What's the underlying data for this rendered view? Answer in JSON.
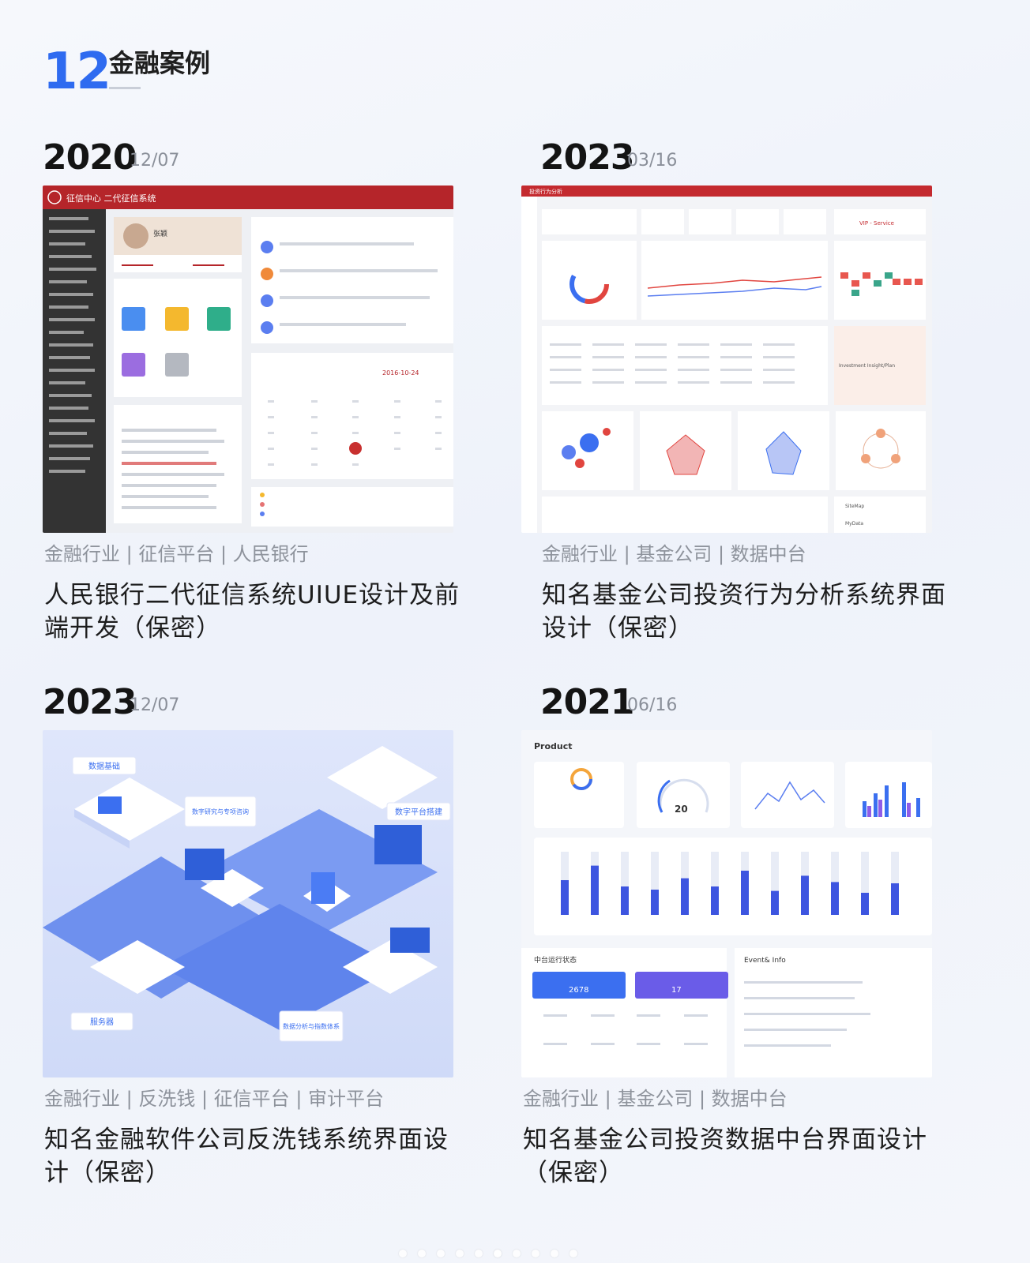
{
  "section": {
    "number": "12",
    "title": "金融案例"
  },
  "cases": [
    {
      "year": "2020",
      "date": "12/07",
      "tags": "金融行业 | 征信平台 | 人民银行",
      "title": "人民银行二代征信系统UIUE设计及前端开发（保密）",
      "screenshot": {
        "kind": "dashboard",
        "accent": "#b5252a",
        "header_title": "征信中心 二代征信系统",
        "user_name": "张颖",
        "calendar_date": "2016-10-24"
      }
    },
    {
      "year": "2023",
      "date": "03/16",
      "tags": "金融行业 | 基金公司 | 数据中台",
      "title": "知名基金公司投资行为分析系统界面设计（保密）",
      "screenshot": {
        "kind": "analytics",
        "accent": "#c42a2f",
        "header_title": "投资行为分析",
        "promo_text": "VIP - Service",
        "insight_text": "Investment Insight/Plan",
        "nav_items": [
          "SiteMap",
          "MyData"
        ]
      }
    },
    {
      "year": "2023",
      "date": "12/07",
      "tags": "金融行业 | 反洗钱 | 征信平台 | 审计平台",
      "title": "知名金融软件公司反洗钱系统界面设计（保密）",
      "screenshot": {
        "kind": "isometric",
        "accent": "#3b6ff0",
        "labels": [
          "数据基础",
          "数字研究与专项咨询",
          "数字平台搭建",
          "服务器",
          "数据分析与指数体系"
        ]
      }
    },
    {
      "year": "2021",
      "date": "06/16",
      "tags": "金融行业 | 基金公司 | 数据中台",
      "title": "知名基金公司投资数据中台界面设计（保密）",
      "screenshot": {
        "kind": "data-center",
        "accent": "#3d55e0",
        "product_label": "Product",
        "gauge_value": "20",
        "status_title": "中台运行状态",
        "event_title": "Event& Info",
        "card_values": [
          "2678",
          "17"
        ],
        "bar_values": [
          55,
          78,
          45,
          40,
          58,
          45,
          70,
          38,
          62,
          52,
          35,
          50
        ]
      }
    }
  ]
}
